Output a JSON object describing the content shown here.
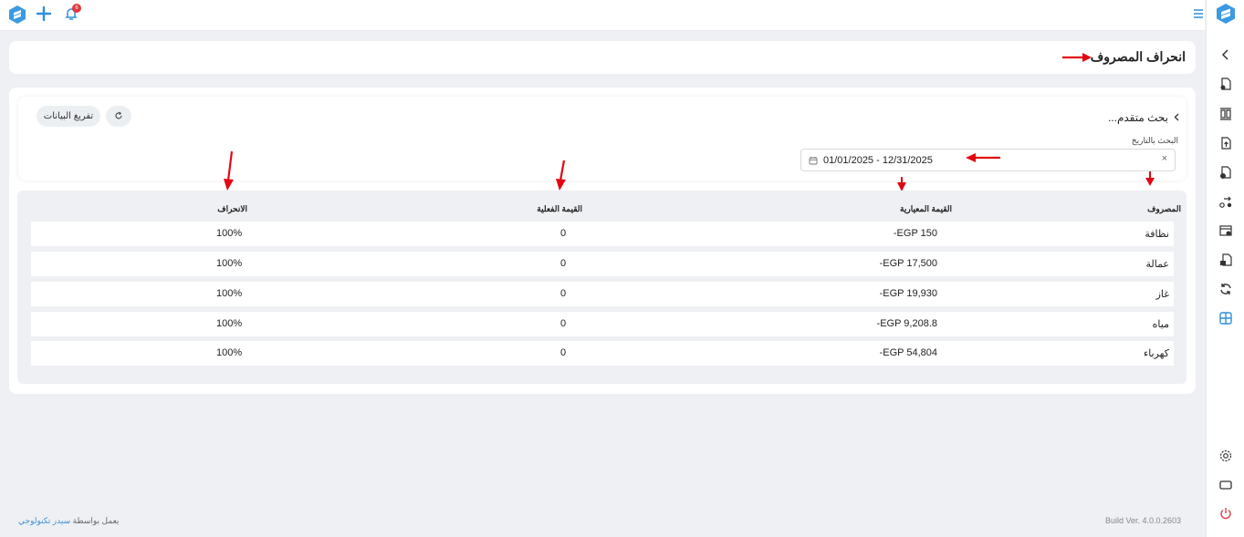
{
  "topbar": {
    "notification_count": "6",
    "icons": [
      "app-logo-icon",
      "plus-icon",
      "bell-icon",
      "hamburger-menu-icon"
    ]
  },
  "page": {
    "title": "انحراف المصروف"
  },
  "filters": {
    "clear_button_label": "تفريغ البيانات",
    "advanced_search_label": "بحث متقدم...",
    "date_search_label": "البحث بالتاريخ",
    "date_range_value": "01/01/2025 - 12/31/2025",
    "date_clear_symbol": "×"
  },
  "table": {
    "headers": {
      "expense": "المصروف",
      "standard_value": "القيمة المعيارية",
      "actual_value": "القيمة الفعلية",
      "deviation": "الانحراف"
    },
    "rows": [
      {
        "expense": "نظافة",
        "standard_value": "-EGP 150",
        "actual_value": "0",
        "deviation": "100%"
      },
      {
        "expense": "عمالة",
        "standard_value": "-EGP 17,500",
        "actual_value": "0",
        "deviation": "100%"
      },
      {
        "expense": "غاز",
        "standard_value": "-EGP 19,930",
        "actual_value": "0",
        "deviation": "100%"
      },
      {
        "expense": "مياه",
        "standard_value": "-EGP 9,208.8",
        "actual_value": "0",
        "deviation": "100%"
      },
      {
        "expense": "كهرباء",
        "standard_value": "-EGP 54,804",
        "actual_value": "0",
        "deviation": "100%"
      }
    ]
  },
  "footer": {
    "powered_by_prefix": "يعمل بواسطة",
    "powered_by_link": "سيدر تكنولوجي",
    "build_version": "Build Ver. 4.0.0.2603"
  },
  "colors": {
    "accent": "#2f8fdc",
    "badge": "#e2373f",
    "annotation_arrow": "#e30613",
    "power_icon": "#d94350"
  }
}
